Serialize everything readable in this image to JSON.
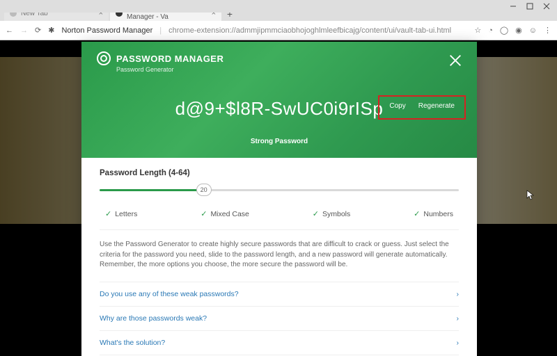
{
  "window": {
    "tabs": [
      {
        "title": "New Tab"
      },
      {
        "title": "Norton Password Manager - Va"
      }
    ],
    "ext_label": "Norton Password Manager",
    "url": "chrome-extension://admmjipmmciaobhojoghlmleefbicajg/content/ui/vault-tab-ui.html"
  },
  "modal": {
    "brand_title": "PASSWORD MANAGER",
    "brand_sub": "Password Generator",
    "password": "d@9+$l8R-SwUC0i9rISp",
    "copy_label": "Copy",
    "regen_label": "Regenerate",
    "strength_label": "Strong Password",
    "length_label": "Password Length (4-64)",
    "length_value": "20",
    "checks": {
      "letters": "Letters",
      "mixed": "Mixed Case",
      "symbols": "Symbols",
      "numbers": "Numbers"
    },
    "description": "Use the Password Generator to create highly secure passwords that are difficult to crack or guess. Just select the criteria for the password you need, slide to the password length, and a new password will generate automatically. Remember, the more options you choose, the more secure the password will be.",
    "faq": [
      "Do you use any of these weak passwords?",
      "Why are those passwords weak?",
      "What's the solution?"
    ]
  }
}
